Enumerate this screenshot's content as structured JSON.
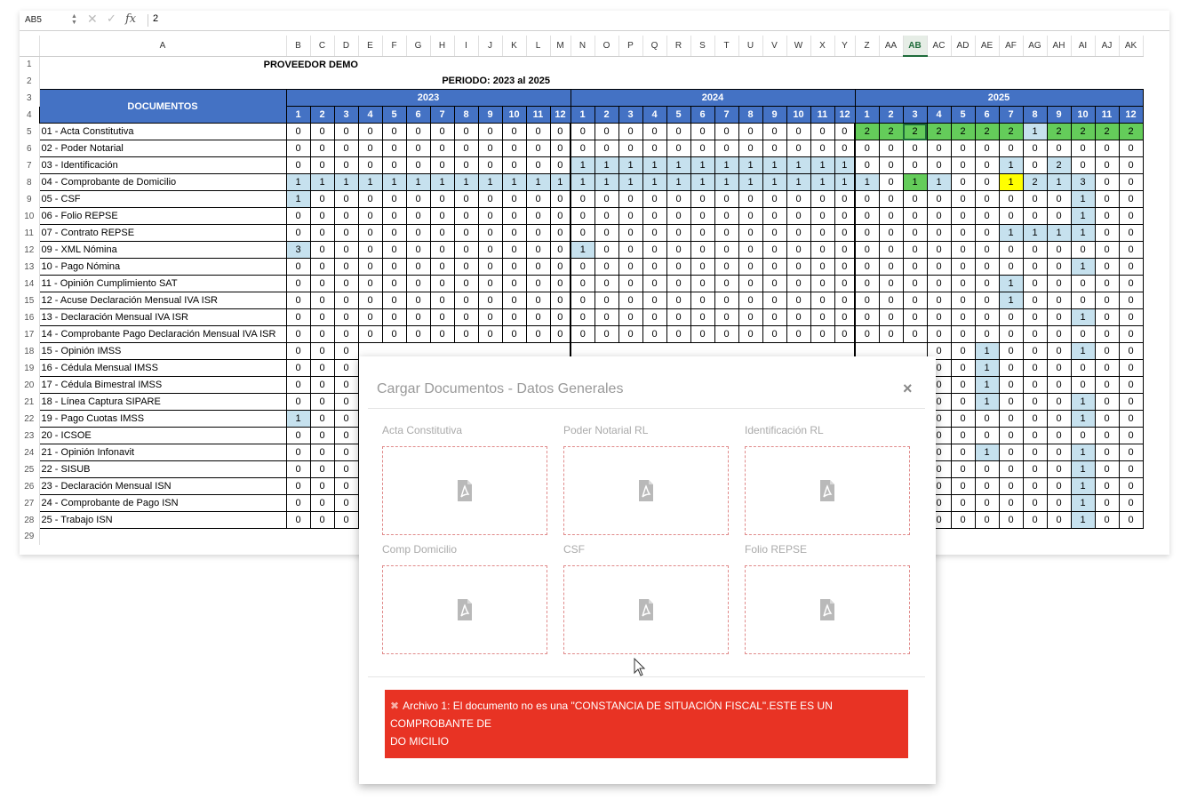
{
  "formula_bar": {
    "cell_ref": "AB5",
    "value": "2"
  },
  "columns": [
    "A",
    "B",
    "C",
    "D",
    "E",
    "F",
    "G",
    "H",
    "I",
    "J",
    "K",
    "L",
    "M",
    "N",
    "O",
    "P",
    "Q",
    "R",
    "S",
    "T",
    "U",
    "V",
    "W",
    "X",
    "Y",
    "Z",
    "AA",
    "AB",
    "AC",
    "AD",
    "AE",
    "AF",
    "AG",
    "AH",
    "AI",
    "AJ",
    "AK"
  ],
  "selected_column": "AB",
  "title": "PROVEEDOR DEMO",
  "period": "PERIODO: 2023 al 2025",
  "documents_header": "DOCUMENTOS",
  "years": [
    "2023",
    "2024",
    "2025"
  ],
  "months": [
    "1",
    "2",
    "3",
    "4",
    "5",
    "6",
    "7",
    "8",
    "9",
    "10",
    "11",
    "12"
  ],
  "row_numbers": [
    "1",
    "2",
    "3",
    "4",
    "5",
    "6",
    "7",
    "8",
    "9",
    "10",
    "11",
    "12",
    "13",
    "14",
    "15",
    "16",
    "17",
    "18",
    "19",
    "20",
    "21",
    "22",
    "23",
    "24",
    "25",
    "26",
    "27",
    "28",
    "29"
  ],
  "documents": [
    "01 - Acta Constitutiva",
    "02 - Poder Notarial",
    "03 - Identificación",
    "04 - Comprobante de Domicilio",
    "05 - CSF",
    "06 - Folio REPSE",
    "07 - Contrato REPSE",
    "09 - XML Nómina",
    "10 - Pago Nómina",
    "11 - Opinión Cumplimiento SAT",
    "12 - Acuse Declaración Mensual IVA ISR",
    "13 - Declaración Mensual IVA ISR",
    "14 - Comprobante Pago Declaración Mensual IVA ISR",
    "15 - Opinión IMSS",
    "16 - Cédula Mensual IMSS",
    "17 - Cédula Bimestral IMSS",
    "18 - Línea Captura SIPARE",
    "19 - Pago Cuotas IMSS",
    "20 - ICSOE",
    "21 - Opinión Infonavit",
    "22 - SISUB",
    "23 - Declaración Mensual ISN",
    "24 - Comprobante de Pago ISN",
    "25 - Trabajo ISN"
  ],
  "values": [
    [
      "0",
      "0",
      "0",
      "0",
      "0",
      "0",
      "0",
      "0",
      "0",
      "0",
      "0",
      "0",
      "0",
      "0",
      "0",
      "0",
      "0",
      "0",
      "0",
      "0",
      "0",
      "0",
      "0",
      "0",
      "2",
      "2",
      "2",
      "2",
      "2",
      "2",
      "2",
      "1",
      "2",
      "2",
      "2",
      "2"
    ],
    [
      "0",
      "0",
      "0",
      "0",
      "0",
      "0",
      "0",
      "0",
      "0",
      "0",
      "0",
      "0",
      "0",
      "0",
      "0",
      "0",
      "0",
      "0",
      "0",
      "0",
      "0",
      "0",
      "0",
      "0",
      "0",
      "0",
      "0",
      "0",
      "0",
      "0",
      "0",
      "0",
      "0",
      "0",
      "0",
      "0"
    ],
    [
      "0",
      "0",
      "0",
      "0",
      "0",
      "0",
      "0",
      "0",
      "0",
      "0",
      "0",
      "0",
      "1",
      "1",
      "1",
      "1",
      "1",
      "1",
      "1",
      "1",
      "1",
      "1",
      "1",
      "1",
      "0",
      "0",
      "0",
      "0",
      "0",
      "0",
      "1",
      "0",
      "2",
      "0",
      "0",
      "0"
    ],
    [
      "1",
      "1",
      "1",
      "1",
      "1",
      "1",
      "1",
      "1",
      "1",
      "1",
      "1",
      "1",
      "1",
      "1",
      "1",
      "1",
      "1",
      "1",
      "1",
      "1",
      "1",
      "1",
      "1",
      "1",
      "1",
      "0",
      "1",
      "1",
      "0",
      "0",
      "1",
      "2",
      "1",
      "3",
      "0",
      "0"
    ],
    [
      "1",
      "0",
      "0",
      "0",
      "0",
      "0",
      "0",
      "0",
      "0",
      "0",
      "0",
      "0",
      "0",
      "0",
      "0",
      "0",
      "0",
      "0",
      "0",
      "0",
      "0",
      "0",
      "0",
      "0",
      "0",
      "0",
      "0",
      "0",
      "0",
      "0",
      "0",
      "0",
      "0",
      "1",
      "0",
      "0"
    ],
    [
      "0",
      "0",
      "0",
      "0",
      "0",
      "0",
      "0",
      "0",
      "0",
      "0",
      "0",
      "0",
      "0",
      "0",
      "0",
      "0",
      "0",
      "0",
      "0",
      "0",
      "0",
      "0",
      "0",
      "0",
      "0",
      "0",
      "0",
      "0",
      "0",
      "0",
      "0",
      "0",
      "0",
      "1",
      "0",
      "0"
    ],
    [
      "0",
      "0",
      "0",
      "0",
      "0",
      "0",
      "0",
      "0",
      "0",
      "0",
      "0",
      "0",
      "0",
      "0",
      "0",
      "0",
      "0",
      "0",
      "0",
      "0",
      "0",
      "0",
      "0",
      "0",
      "0",
      "0",
      "0",
      "0",
      "0",
      "0",
      "1",
      "1",
      "1",
      "1",
      "0",
      "0"
    ],
    [
      "3",
      "0",
      "0",
      "0",
      "0",
      "0",
      "0",
      "0",
      "0",
      "0",
      "0",
      "0",
      "1",
      "0",
      "0",
      "0",
      "0",
      "0",
      "0",
      "0",
      "0",
      "0",
      "0",
      "0",
      "0",
      "0",
      "0",
      "0",
      "0",
      "0",
      "0",
      "0",
      "0",
      "0",
      "0",
      "0"
    ],
    [
      "0",
      "0",
      "0",
      "0",
      "0",
      "0",
      "0",
      "0",
      "0",
      "0",
      "0",
      "0",
      "0",
      "0",
      "0",
      "0",
      "0",
      "0",
      "0",
      "0",
      "0",
      "0",
      "0",
      "0",
      "0",
      "0",
      "0",
      "0",
      "0",
      "0",
      "0",
      "0",
      "0",
      "1",
      "0",
      "0"
    ],
    [
      "0",
      "0",
      "0",
      "0",
      "0",
      "0",
      "0",
      "0",
      "0",
      "0",
      "0",
      "0",
      "0",
      "0",
      "0",
      "0",
      "0",
      "0",
      "0",
      "0",
      "0",
      "0",
      "0",
      "0",
      "0",
      "0",
      "0",
      "0",
      "0",
      "0",
      "1",
      "0",
      "0",
      "0",
      "0",
      "0"
    ],
    [
      "0",
      "0",
      "0",
      "0",
      "0",
      "0",
      "0",
      "0",
      "0",
      "0",
      "0",
      "0",
      "0",
      "0",
      "0",
      "0",
      "0",
      "0",
      "0",
      "0",
      "0",
      "0",
      "0",
      "0",
      "0",
      "0",
      "0",
      "0",
      "0",
      "0",
      "1",
      "0",
      "0",
      "0",
      "0",
      "0"
    ],
    [
      "0",
      "0",
      "0",
      "0",
      "0",
      "0",
      "0",
      "0",
      "0",
      "0",
      "0",
      "0",
      "0",
      "0",
      "0",
      "0",
      "0",
      "0",
      "0",
      "0",
      "0",
      "0",
      "0",
      "0",
      "0",
      "0",
      "0",
      "0",
      "0",
      "0",
      "0",
      "0",
      "0",
      "1",
      "0",
      "0"
    ],
    [
      "0",
      "0",
      "0",
      "0",
      "0",
      "0",
      "0",
      "0",
      "0",
      "0",
      "0",
      "0",
      "0",
      "0",
      "0",
      "0",
      "0",
      "0",
      "0",
      "0",
      "0",
      "0",
      "0",
      "0",
      "0",
      "0",
      "0",
      "0",
      "0",
      "0",
      "0",
      "0",
      "0",
      "0",
      "0",
      "0"
    ],
    [
      "0",
      "0",
      "0",
      "",
      "",
      "",
      "",
      "",
      "",
      "",
      "",
      "",
      "",
      "",
      "",
      "",
      "",
      "",
      "",
      "",
      "",
      "",
      "",
      "",
      "",
      "",
      "",
      "0",
      "0",
      "1",
      "0",
      "0",
      "0",
      "1",
      "0",
      "0"
    ],
    [
      "0",
      "0",
      "0",
      "",
      "",
      "",
      "",
      "",
      "",
      "",
      "",
      "",
      "",
      "",
      "",
      "",
      "",
      "",
      "",
      "",
      "",
      "",
      "",
      "",
      "",
      "",
      "",
      "0",
      "0",
      "1",
      "0",
      "0",
      "0",
      "0",
      "0",
      "0"
    ],
    [
      "0",
      "0",
      "0",
      "",
      "",
      "",
      "",
      "",
      "",
      "",
      "",
      "",
      "",
      "",
      "",
      "",
      "",
      "",
      "",
      "",
      "",
      "",
      "",
      "",
      "",
      "",
      "",
      "0",
      "0",
      "1",
      "0",
      "0",
      "0",
      "0",
      "0",
      "0"
    ],
    [
      "0",
      "0",
      "0",
      "",
      "",
      "",
      "",
      "",
      "",
      "",
      "",
      "",
      "",
      "",
      "",
      "",
      "",
      "",
      "",
      "",
      "",
      "",
      "",
      "",
      "",
      "",
      "",
      "0",
      "0",
      "1",
      "0",
      "0",
      "0",
      "1",
      "0",
      "0"
    ],
    [
      "1",
      "0",
      "0",
      "",
      "",
      "",
      "",
      "",
      "",
      "",
      "",
      "",
      "",
      "",
      "",
      "",
      "",
      "",
      "",
      "",
      "",
      "",
      "",
      "",
      "",
      "",
      "",
      "0",
      "0",
      "0",
      "0",
      "0",
      "0",
      "1",
      "0",
      "0"
    ],
    [
      "0",
      "0",
      "0",
      "",
      "",
      "",
      "",
      "",
      "",
      "",
      "",
      "",
      "",
      "",
      "",
      "",
      "",
      "",
      "",
      "",
      "",
      "",
      "",
      "",
      "",
      "",
      "",
      "0",
      "0",
      "0",
      "0",
      "0",
      "0",
      "0",
      "0",
      "0"
    ],
    [
      "0",
      "0",
      "0",
      "",
      "",
      "",
      "",
      "",
      "",
      "",
      "",
      "",
      "",
      "",
      "",
      "",
      "",
      "",
      "",
      "",
      "",
      "",
      "",
      "",
      "",
      "",
      "",
      "0",
      "0",
      "1",
      "0",
      "0",
      "0",
      "1",
      "0",
      "0"
    ],
    [
      "0",
      "0",
      "0",
      "",
      "",
      "",
      "",
      "",
      "",
      "",
      "",
      "",
      "",
      "",
      "",
      "",
      "",
      "",
      "",
      "",
      "",
      "",
      "",
      "",
      "",
      "",
      "",
      "0",
      "0",
      "0",
      "0",
      "0",
      "0",
      "1",
      "0",
      "0"
    ],
    [
      "0",
      "0",
      "0",
      "",
      "",
      "",
      "",
      "",
      "",
      "",
      "",
      "",
      "",
      "",
      "",
      "",
      "",
      "",
      "",
      "",
      "",
      "",
      "",
      "",
      "",
      "",
      "",
      "0",
      "0",
      "0",
      "0",
      "0",
      "0",
      "1",
      "0",
      "0"
    ],
    [
      "0",
      "0",
      "0",
      "",
      "",
      "",
      "",
      "",
      "",
      "",
      "",
      "",
      "",
      "",
      "",
      "",
      "",
      "",
      "",
      "",
      "",
      "",
      "",
      "",
      "",
      "",
      "",
      "0",
      "0",
      "0",
      "0",
      "0",
      "0",
      "1",
      "0",
      "0"
    ],
    [
      "0",
      "0",
      "0",
      "",
      "",
      "",
      "",
      "",
      "",
      "",
      "",
      "",
      "",
      "",
      "",
      "",
      "",
      "",
      "",
      "",
      "",
      "",
      "",
      "",
      "",
      "",
      "",
      "0",
      "0",
      "0",
      "0",
      "0",
      "0",
      "1",
      "0",
      "0"
    ]
  ],
  "cell_colors": {
    "light_blue": "#c6e1ee",
    "green": "#64cc5a",
    "yellow": "#ffff00",
    "header_blue": "#4472c4"
  },
  "dialog": {
    "title": "Cargar Documentos - Datos Generales",
    "close": "×",
    "slots": [
      {
        "label": "Acta Constitutiva",
        "icon": "pdf-icon"
      },
      {
        "label": "Poder Notarial RL",
        "icon": "pdf-icon"
      },
      {
        "label": "Identificación RL",
        "icon": "pdf-icon"
      },
      {
        "label": "Comp Domicilio",
        "icon": "pdf-icon"
      },
      {
        "label": "CSF",
        "icon": "pdf-icon"
      },
      {
        "label": "Folio REPSE",
        "icon": "pdf-icon"
      }
    ],
    "error_lines": [
      "Archivo 1: El documento no es una \"CONSTANCIA DE SITUACIÓN FISCAL\".ESTE ES UN",
      "COMPROBANTE    DE",
      "DO  MICILIO"
    ],
    "error_color": "#e83324"
  }
}
